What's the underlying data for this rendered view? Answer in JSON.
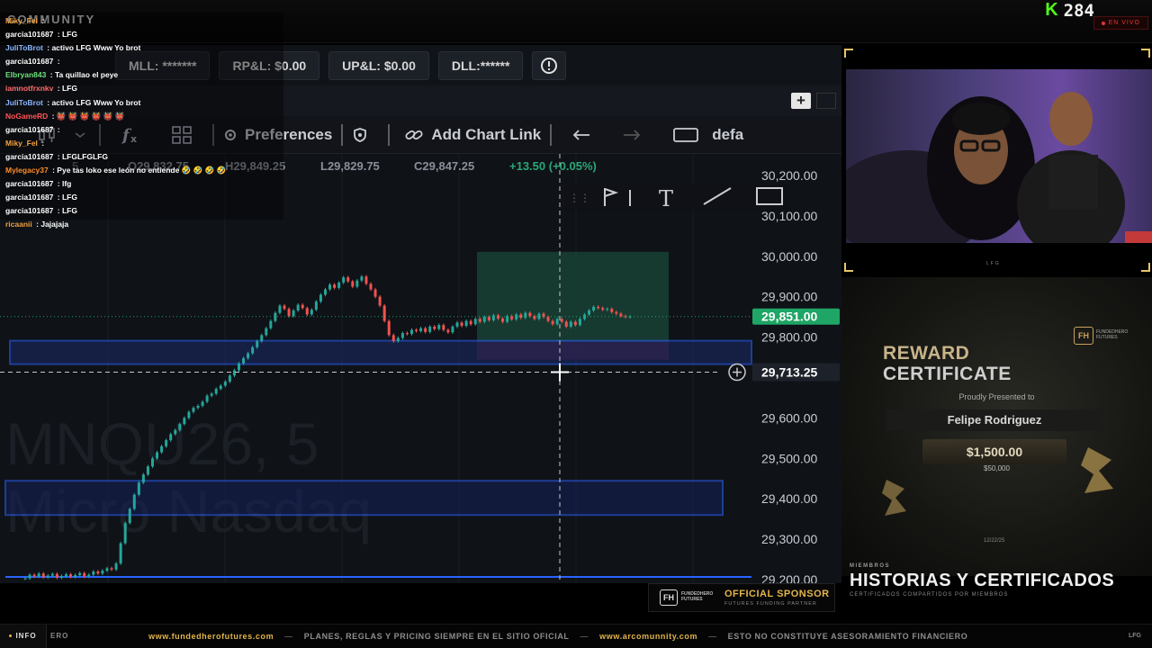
{
  "topbar": {
    "brand": "COMMUNITY",
    "viewer_count": "284",
    "viewer_icon": "kick-logo-icon",
    "live_label": "EN VIVO"
  },
  "account_bar": {
    "boxes": [
      "MLL: *******",
      "RP&L: $0.00",
      "UP&L: $0.00",
      "DLL:******"
    ],
    "alert_icon": "alert-circle-icon"
  },
  "toolbar": {
    "preferences": "Preferences",
    "add_chart_link": "Add Chart Link",
    "default_label": "defa"
  },
  "chart_data": {
    "type": "candlestick",
    "ohlc": {
      "open_label": "O29,832.75",
      "high_label": "H29,849.25",
      "low_label": "L29,829.75",
      "close_label": "C29,847.25",
      "change_label": "+13.50 (+0.05%)",
      "interval_label": "5"
    },
    "watermark_symbol": "MNQU26, 5",
    "watermark_name": "Micro Nasdaq",
    "y_ticks": [
      "30,200.00",
      "30,100.00",
      "30,000.00",
      "29,900.00",
      "29,800.00",
      "29,600.00",
      "29,500.00",
      "29,400.00",
      "29,300.00",
      "29,200.00"
    ],
    "ylim": [
      29200,
      30200
    ],
    "current_price": 29851.0,
    "current_price_label": "29,851.00",
    "crosshair_price": 29713.25,
    "crosshair_price_label": "29,713.25",
    "close_series": [
      29203,
      29212,
      29208,
      29215,
      29206,
      29210,
      29214,
      29205,
      29209,
      29213,
      29207,
      29211,
      29216,
      29208,
      29212,
      29220,
      29215,
      29222,
      29228,
      29225,
      29240,
      29290,
      29340,
      29375,
      29410,
      29440,
      29460,
      29480,
      29500,
      29515,
      29530,
      29545,
      29560,
      29570,
      29585,
      29600,
      29615,
      29625,
      29630,
      29640,
      29655,
      29660,
      29672,
      29680,
      29690,
      29705,
      29718,
      29735,
      29748,
      29760,
      29775,
      29790,
      29805,
      29822,
      29840,
      29860,
      29878,
      29870,
      29852,
      29866,
      29880,
      29872,
      29856,
      29868,
      29888,
      29905,
      29918,
      29930,
      29922,
      29935,
      29948,
      29938,
      29925,
      29940,
      29950,
      29932,
      29918,
      29900,
      29878,
      29840,
      29805,
      29790,
      29798,
      29810,
      29808,
      29818,
      29815,
      29822,
      29813,
      29826,
      29820,
      29830,
      29818,
      29812,
      29826,
      29836,
      29828,
      29840,
      29832,
      29845,
      29838,
      29850,
      29842,
      29854,
      29846,
      29838,
      29852,
      29844,
      29856,
      29848,
      29860,
      29852,
      29845,
      29858,
      29850,
      29840,
      29832,
      29845,
      29838,
      29826,
      29838,
      29830,
      29845,
      29856,
      29866,
      29875,
      29872,
      29868,
      29870,
      29862,
      29858,
      29852,
      29850,
      29851
    ]
  },
  "chat": [
    {
      "user": "Miky_Fel",
      "msg": "",
      "color": "#f0a040"
    },
    {
      "user": "garcia101687",
      "msg": "LFG",
      "color": "#ffffff"
    },
    {
      "user": "JuliToBrot",
      "msg": "activo LFG Www Yo brot",
      "color": "#8ab4ff"
    },
    {
      "user": "garcia101687",
      "msg": "",
      "color": "#ffffff"
    },
    {
      "user": "Elbryan843",
      "msg": "Ta quillao el peye",
      "color": "#6ee07a"
    },
    {
      "user": "iamnotfrxnkv",
      "msg": "LFG",
      "color": "#ff6b6b"
    },
    {
      "user": "JuliToBrot",
      "msg": "activo LFG Www Yo brot",
      "color": "#8ab4ff"
    },
    {
      "user": "NoGameRD",
      "msg": "👹 👹 👹 👹 👹 👹",
      "color": "#ff5555"
    },
    {
      "user": "garcia101687",
      "msg": "",
      "color": "#ffffff"
    },
    {
      "user": "Miky_Fel",
      "msg": "",
      "color": "#f0a040"
    },
    {
      "user": "garcia101687",
      "msg": "LFGLFGLFG",
      "color": "#ffffff"
    },
    {
      "user": "Mylegacy37",
      "msg": "Pye tas loko ese león no entiende 🤣 🤣 🤣 🤣",
      "color": "#ff8c2b"
    },
    {
      "user": "garcia101687",
      "msg": "lfg",
      "color": "#ffffff"
    },
    {
      "user": "garcia101687",
      "msg": "LFG",
      "color": "#ffffff"
    },
    {
      "user": "garcia101687",
      "msg": "LFG",
      "color": "#ffffff"
    },
    {
      "user": "ricaanii",
      "msg": "Jajajaja",
      "color": "#f0a040"
    }
  ],
  "cam": {
    "label": "LFG"
  },
  "certificate": {
    "title_line1": "REWARD",
    "title_line2": "CERTIFICATE",
    "presented": "Proudly Presented to",
    "name": "Felipe Rodriguez",
    "amount": "$1,500.00",
    "sub_amount": "$50,000",
    "date": "12/22/25",
    "logo_mark": "FH",
    "logo_line1": "FUNDEDHERO",
    "logo_line2": "FUTURES"
  },
  "historias": {
    "kicker": "MIEMBROS",
    "title": "HISTORIAS Y CERTIFICADOS",
    "subtitle": "CERTIFICADOS COMPARTIDOS POR MIEMBROS"
  },
  "sponsor": {
    "logo_mark": "FH",
    "logo_line1": "FUNDEDHERO",
    "logo_line2": "FUTURES",
    "title": "OFFICIAL SPONSOR",
    "subtitle": "FUTURES FUNDING PARTNER"
  },
  "ticker": {
    "tag": "INFO",
    "prefix": "ERO",
    "items": [
      {
        "kind": "link",
        "text": "www.fundedherofutures.com"
      },
      {
        "kind": "text",
        "text": "PLANES, REGLAS Y PRICING SIEMPRE EN EL SITIO OFICIAL"
      },
      {
        "kind": "link",
        "text": "www.arcomunnity.com"
      },
      {
        "kind": "text",
        "text": "ESTO NO CONSTITUYE ASESORAMIENTO FINANCIERO"
      }
    ],
    "right": "LFG"
  },
  "colors": {
    "chart_bg": "#0f1217",
    "candle_up": "#26a69a",
    "candle_down": "#ef5350",
    "price_badge": "#1fa565",
    "zone_blue": "#2962ff",
    "accent_gold": "#e3b54c"
  }
}
